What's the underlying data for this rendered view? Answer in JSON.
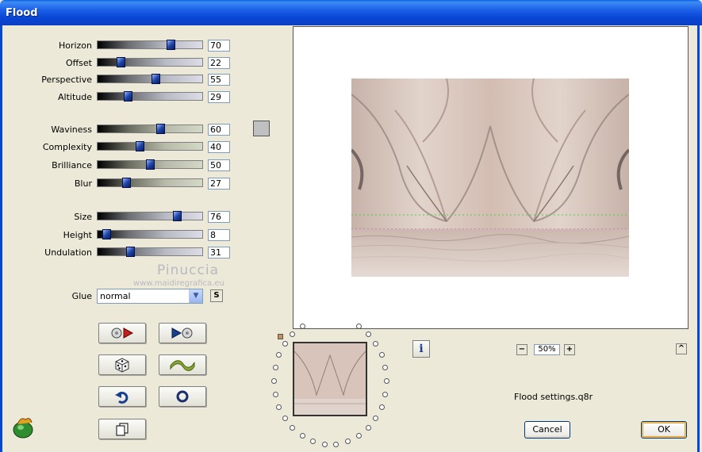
{
  "window": {
    "title": "Flood"
  },
  "sliders": [
    {
      "label": "Horizon",
      "value": "70",
      "fraction": 0.7,
      "style": "gray"
    },
    {
      "label": "Offset",
      "value": "22",
      "fraction": 0.22,
      "style": "gray"
    },
    {
      "label": "Perspective",
      "value": "55",
      "fraction": 0.55,
      "style": "gray"
    },
    {
      "label": "Altitude",
      "value": "29",
      "fraction": 0.29,
      "style": "gray"
    },
    {
      "label": "Waviness",
      "value": "60",
      "fraction": 0.6,
      "style": "green"
    },
    {
      "label": "Complexity",
      "value": "40",
      "fraction": 0.4,
      "style": "green"
    },
    {
      "label": "Brilliance",
      "value": "50",
      "fraction": 0.5,
      "style": "green"
    },
    {
      "label": "Blur",
      "value": "27",
      "fraction": 0.27,
      "style": "green"
    },
    {
      "label": "Size",
      "value": "76",
      "fraction": 0.76,
      "style": "gray"
    },
    {
      "label": "Height",
      "value": "8",
      "fraction": 0.08,
      "style": "gray"
    },
    {
      "label": "Undulation",
      "value": "31",
      "fraction": 0.31,
      "style": "gray"
    }
  ],
  "watermark": {
    "name": "Pinuccia",
    "url": "www.maidiregrafica.eu"
  },
  "glue": {
    "label": "Glue",
    "value": "normal",
    "s_button": "S"
  },
  "color_swatch": "#c0c0c0",
  "action_buttons": [
    {
      "name": "random-left-button",
      "icon": "dice-arrow-icon"
    },
    {
      "name": "random-right-button",
      "icon": "arrow-dice-icon"
    },
    {
      "name": "randomize-button",
      "icon": "dice-icon"
    },
    {
      "name": "wave-button",
      "icon": "wave-icon"
    },
    {
      "name": "undo-button",
      "icon": "undo-icon"
    },
    {
      "name": "reset-button",
      "icon": "ring-icon"
    },
    {
      "name": "copy-button",
      "icon": "copy-icon"
    }
  ],
  "zoom": {
    "minus": "−",
    "value": "50%",
    "plus": "+"
  },
  "info_button": "i",
  "collapse_button": "^",
  "settings_file": "Flood settings.q8r",
  "buttons": {
    "cancel": "Cancel",
    "ok": "OK"
  },
  "colors": {
    "titlebar": "#0846d4",
    "dialog_bg": "#ece9d8",
    "preview_tint": "#d9c7be"
  }
}
